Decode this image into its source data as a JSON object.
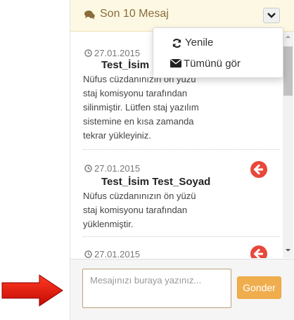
{
  "header": {
    "title": "Son 10 Mesaj",
    "icon": "comments-icon"
  },
  "dropdown": {
    "items": [
      {
        "label": "Yenile",
        "icon": "refresh-icon"
      },
      {
        "label": "Tümünü gör",
        "icon": "envelope-icon"
      }
    ]
  },
  "messages": [
    {
      "date": "27.01.2015",
      "sender": "Test_İsim",
      "lines": [
        "Nüfus cüzdanınızın ön yüzü",
        "staj komisyonu tarafından",
        "silinmiştir. Lütfen staj yazılım",
        "sistemine en kısa zamanda",
        "tekrar yükleyiniz."
      ]
    },
    {
      "date": "27.01.2015",
      "sender": "Test_İsim Test_Soyad",
      "lines": [
        "Nüfus cüzdanınızın ön yüzü",
        "staj komisyonu tarafından",
        "yüklenmiştir."
      ]
    },
    {
      "date": "27.01.2015"
    }
  ],
  "composer": {
    "placeholder": "Mesajınızı buraya yazınız...",
    "send_label": "Gonder"
  },
  "colors": {
    "header_bg": "#fcf8e3",
    "header_text": "#8a6d3b",
    "reply_icon": "#e8473a",
    "send_button": "#f0ad4e",
    "arrow": "#e8120c"
  }
}
